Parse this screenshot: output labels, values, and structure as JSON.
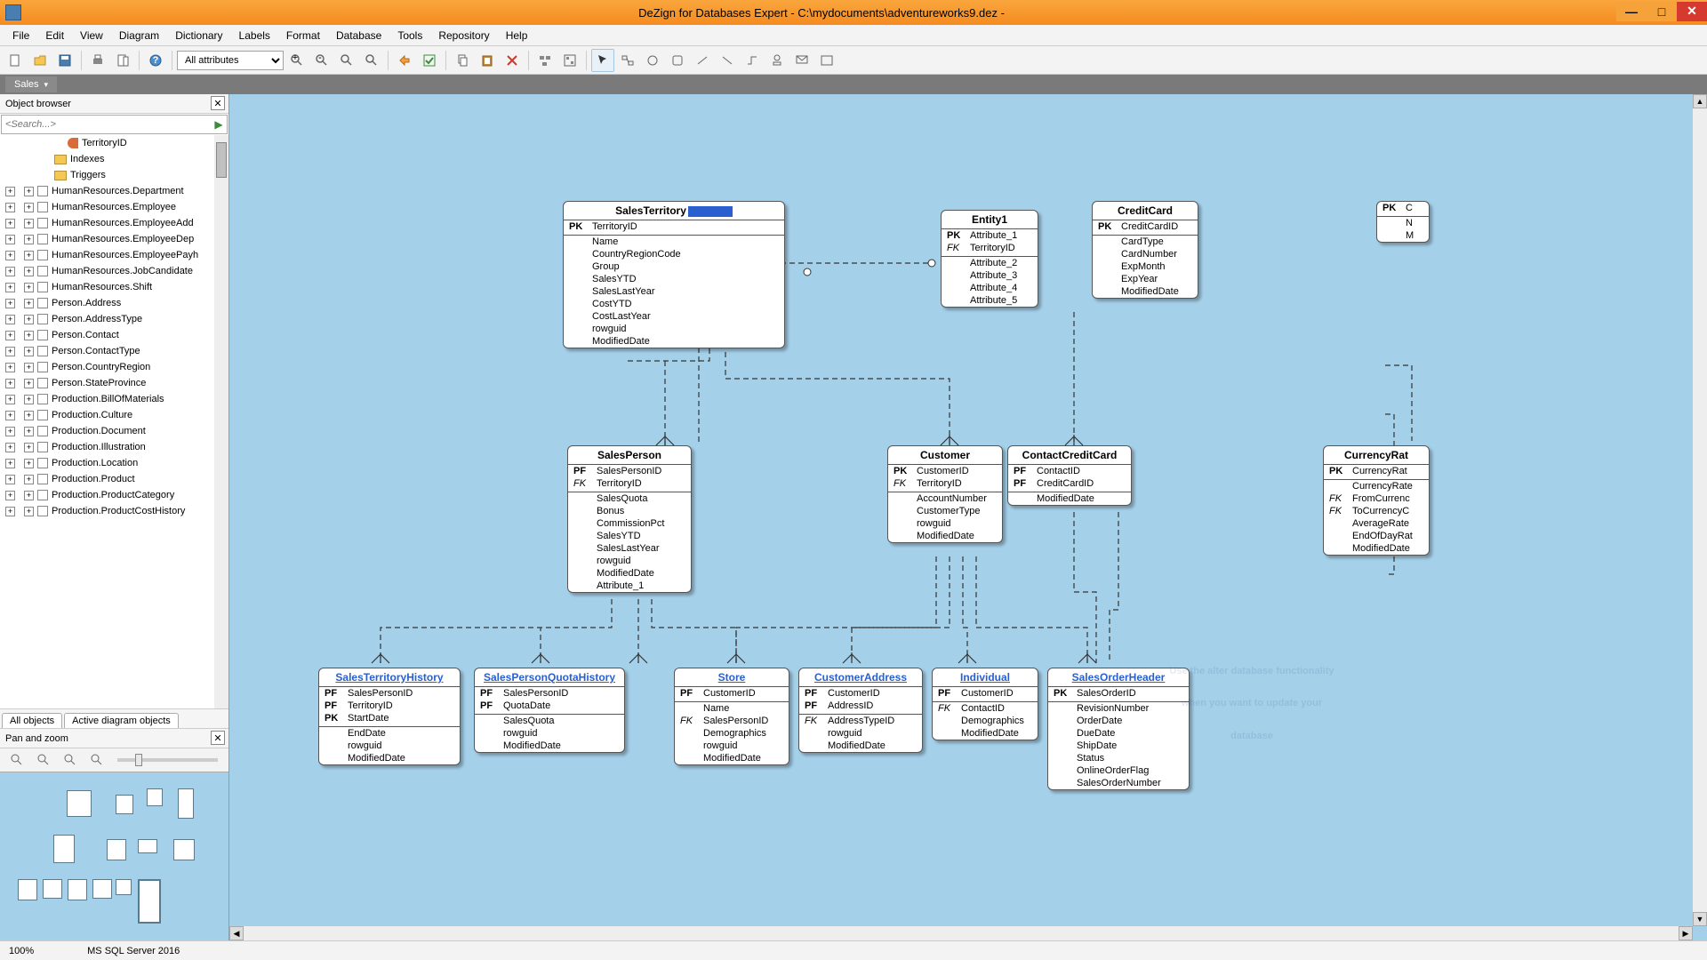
{
  "window": {
    "title": "DeZign for Databases Expert - C:\\mydocuments\\adventureworks9.dez -"
  },
  "menu": [
    "File",
    "Edit",
    "View",
    "Diagram",
    "Dictionary",
    "Labels",
    "Format",
    "Database",
    "Tools",
    "Repository",
    "Help"
  ],
  "toolbar": {
    "combo": "All attributes"
  },
  "tab": {
    "label": "Sales"
  },
  "object_browser": {
    "title": "Object browser",
    "search_placeholder": "<Search...>",
    "top_items": [
      {
        "kind": "key",
        "indent": 70,
        "label": "TerritoryID"
      },
      {
        "kind": "folder",
        "indent": 55,
        "label": "Indexes"
      },
      {
        "kind": "folder",
        "indent": 55,
        "label": "Triggers"
      }
    ],
    "tables": [
      "HumanResources.Department",
      "HumanResources.Employee",
      "HumanResources.EmployeeAdd",
      "HumanResources.EmployeeDep",
      "HumanResources.EmployeePayh",
      "HumanResources.JobCandidate",
      "HumanResources.Shift",
      "Person.Address",
      "Person.AddressType",
      "Person.Contact",
      "Person.ContactType",
      "Person.CountryRegion",
      "Person.StateProvince",
      "Production.BillOfMaterials",
      "Production.Culture",
      "Production.Document",
      "Production.Illustration",
      "Production.Location",
      "Production.Product",
      "Production.ProductCategory",
      "Production.ProductCostHistory"
    ],
    "bottom_tabs": [
      "All objects",
      "Active diagram objects"
    ]
  },
  "pan_zoom": {
    "title": "Pan and zoom"
  },
  "entities": {
    "sales_territory": {
      "name": "SalesTerritory",
      "selected": true,
      "keys": [
        {
          "k": "PK",
          "n": "TerritoryID"
        }
      ],
      "attrs": [
        "Name",
        "CountryRegionCode",
        "Group",
        "SalesYTD",
        "SalesLastYear",
        "CostYTD",
        "CostLastYear",
        "rowguid",
        "ModifiedDate"
      ]
    },
    "entity1": {
      "name": "Entity1",
      "keys": [
        {
          "k": "PK",
          "n": "Attribute_1"
        }
      ],
      "attrs": [
        "Attribute_2",
        "Attribute_3",
        "Attribute_4",
        "Attribute_5"
      ],
      "fks": [
        {
          "k": "FK",
          "n": "TerritoryID"
        }
      ]
    },
    "credit_card": {
      "name": "CreditCard",
      "keys": [
        {
          "k": "PK",
          "n": "CreditCardID"
        }
      ],
      "attrs": [
        "CardType",
        "CardNumber",
        "ExpMonth",
        "ExpYear",
        "ModifiedDate"
      ]
    },
    "cutright": {
      "keys": [
        {
          "k": "PK",
          "n": "C"
        }
      ],
      "attrs": [
        "N",
        "M"
      ]
    },
    "sales_person": {
      "name": "SalesPerson",
      "keys": [
        {
          "k": "PF",
          "n": "SalesPersonID"
        }
      ],
      "fks": [
        {
          "k": "FK",
          "n": "TerritoryID"
        }
      ],
      "attrs": [
        "SalesQuota",
        "Bonus",
        "CommissionPct",
        "SalesYTD",
        "SalesLastYear",
        "rowguid",
        "ModifiedDate",
        "Attribute_1"
      ]
    },
    "customer": {
      "name": "Customer",
      "keys": [
        {
          "k": "PK",
          "n": "CustomerID"
        }
      ],
      "fks": [
        {
          "k": "FK",
          "n": "TerritoryID"
        }
      ],
      "attrs": [
        "AccountNumber",
        "CustomerType",
        "rowguid",
        "ModifiedDate"
      ]
    },
    "contact_credit_card": {
      "name": "ContactCreditCard",
      "keys": [
        {
          "k": "PF",
          "n": "ContactID"
        },
        {
          "k": "PF",
          "n": "CreditCardID"
        }
      ],
      "attrs": [
        "ModifiedDate"
      ]
    },
    "currency_rate": {
      "name": "CurrencyRat",
      "keys": [
        {
          "k": "PK",
          "n": "CurrencyRat"
        }
      ],
      "attrs_k": [
        {
          "k": "",
          "n": "CurrencyRate"
        },
        {
          "k": "FK",
          "n": "FromCurrenc"
        },
        {
          "k": "FK",
          "n": "ToCurrencyC"
        },
        {
          "k": "",
          "n": "AverageRate"
        },
        {
          "k": "",
          "n": "EndOfDayRat"
        },
        {
          "k": "",
          "n": "ModifiedDate"
        }
      ]
    },
    "sth": {
      "name": "SalesTerritoryHistory",
      "keys": [
        {
          "k": "PF",
          "n": "SalesPersonID"
        },
        {
          "k": "PF",
          "n": "TerritoryID"
        },
        {
          "k": "PK",
          "n": "StartDate"
        }
      ],
      "attrs": [
        "EndDate",
        "rowguid",
        "ModifiedDate"
      ]
    },
    "spqh": {
      "name": "SalesPersonQuotaHistory",
      "keys": [
        {
          "k": "PF",
          "n": "SalesPersonID"
        },
        {
          "k": "PF",
          "n": "QuotaDate"
        }
      ],
      "attrs": [
        "SalesQuota",
        "rowguid",
        "ModifiedDate"
      ]
    },
    "store": {
      "name": "Store",
      "keys": [
        {
          "k": "PF",
          "n": "CustomerID"
        }
      ],
      "attrs_k": [
        {
          "k": "",
          "n": "Name"
        },
        {
          "k": "FK",
          "n": "SalesPersonID"
        },
        {
          "k": "",
          "n": "Demographics"
        },
        {
          "k": "",
          "n": "rowguid"
        },
        {
          "k": "",
          "n": "ModifiedDate"
        }
      ]
    },
    "cust_addr": {
      "name": "CustomerAddress",
      "keys": [
        {
          "k": "PF",
          "n": "CustomerID"
        },
        {
          "k": "PF",
          "n": "AddressID"
        }
      ],
      "attrs_k": [
        {
          "k": "FK",
          "n": "AddressTypeID"
        },
        {
          "k": "",
          "n": "rowguid"
        },
        {
          "k": "",
          "n": "ModifiedDate"
        }
      ]
    },
    "individual": {
      "name": "Individual",
      "keys": [
        {
          "k": "PF",
          "n": "CustomerID"
        }
      ],
      "attrs_k": [
        {
          "k": "FK",
          "n": "ContactID"
        },
        {
          "k": "",
          "n": "Demographics"
        },
        {
          "k": "",
          "n": "ModifiedDate"
        }
      ]
    },
    "soh": {
      "name": "SalesOrderHeader",
      "keys": [
        {
          "k": "PK",
          "n": "SalesOrderID"
        }
      ],
      "attrs": [
        "RevisionNumber",
        "OrderDate",
        "DueDate",
        "ShipDate",
        "Status",
        "OnlineOrderFlag",
        "SalesOrderNumber"
      ]
    }
  },
  "overlay": {
    "line1": "Use the alter database functionality",
    "line2": "when you want to update your",
    "line3": "database"
  },
  "status": {
    "zoom": "100%",
    "db": "MS SQL Server 2016"
  }
}
